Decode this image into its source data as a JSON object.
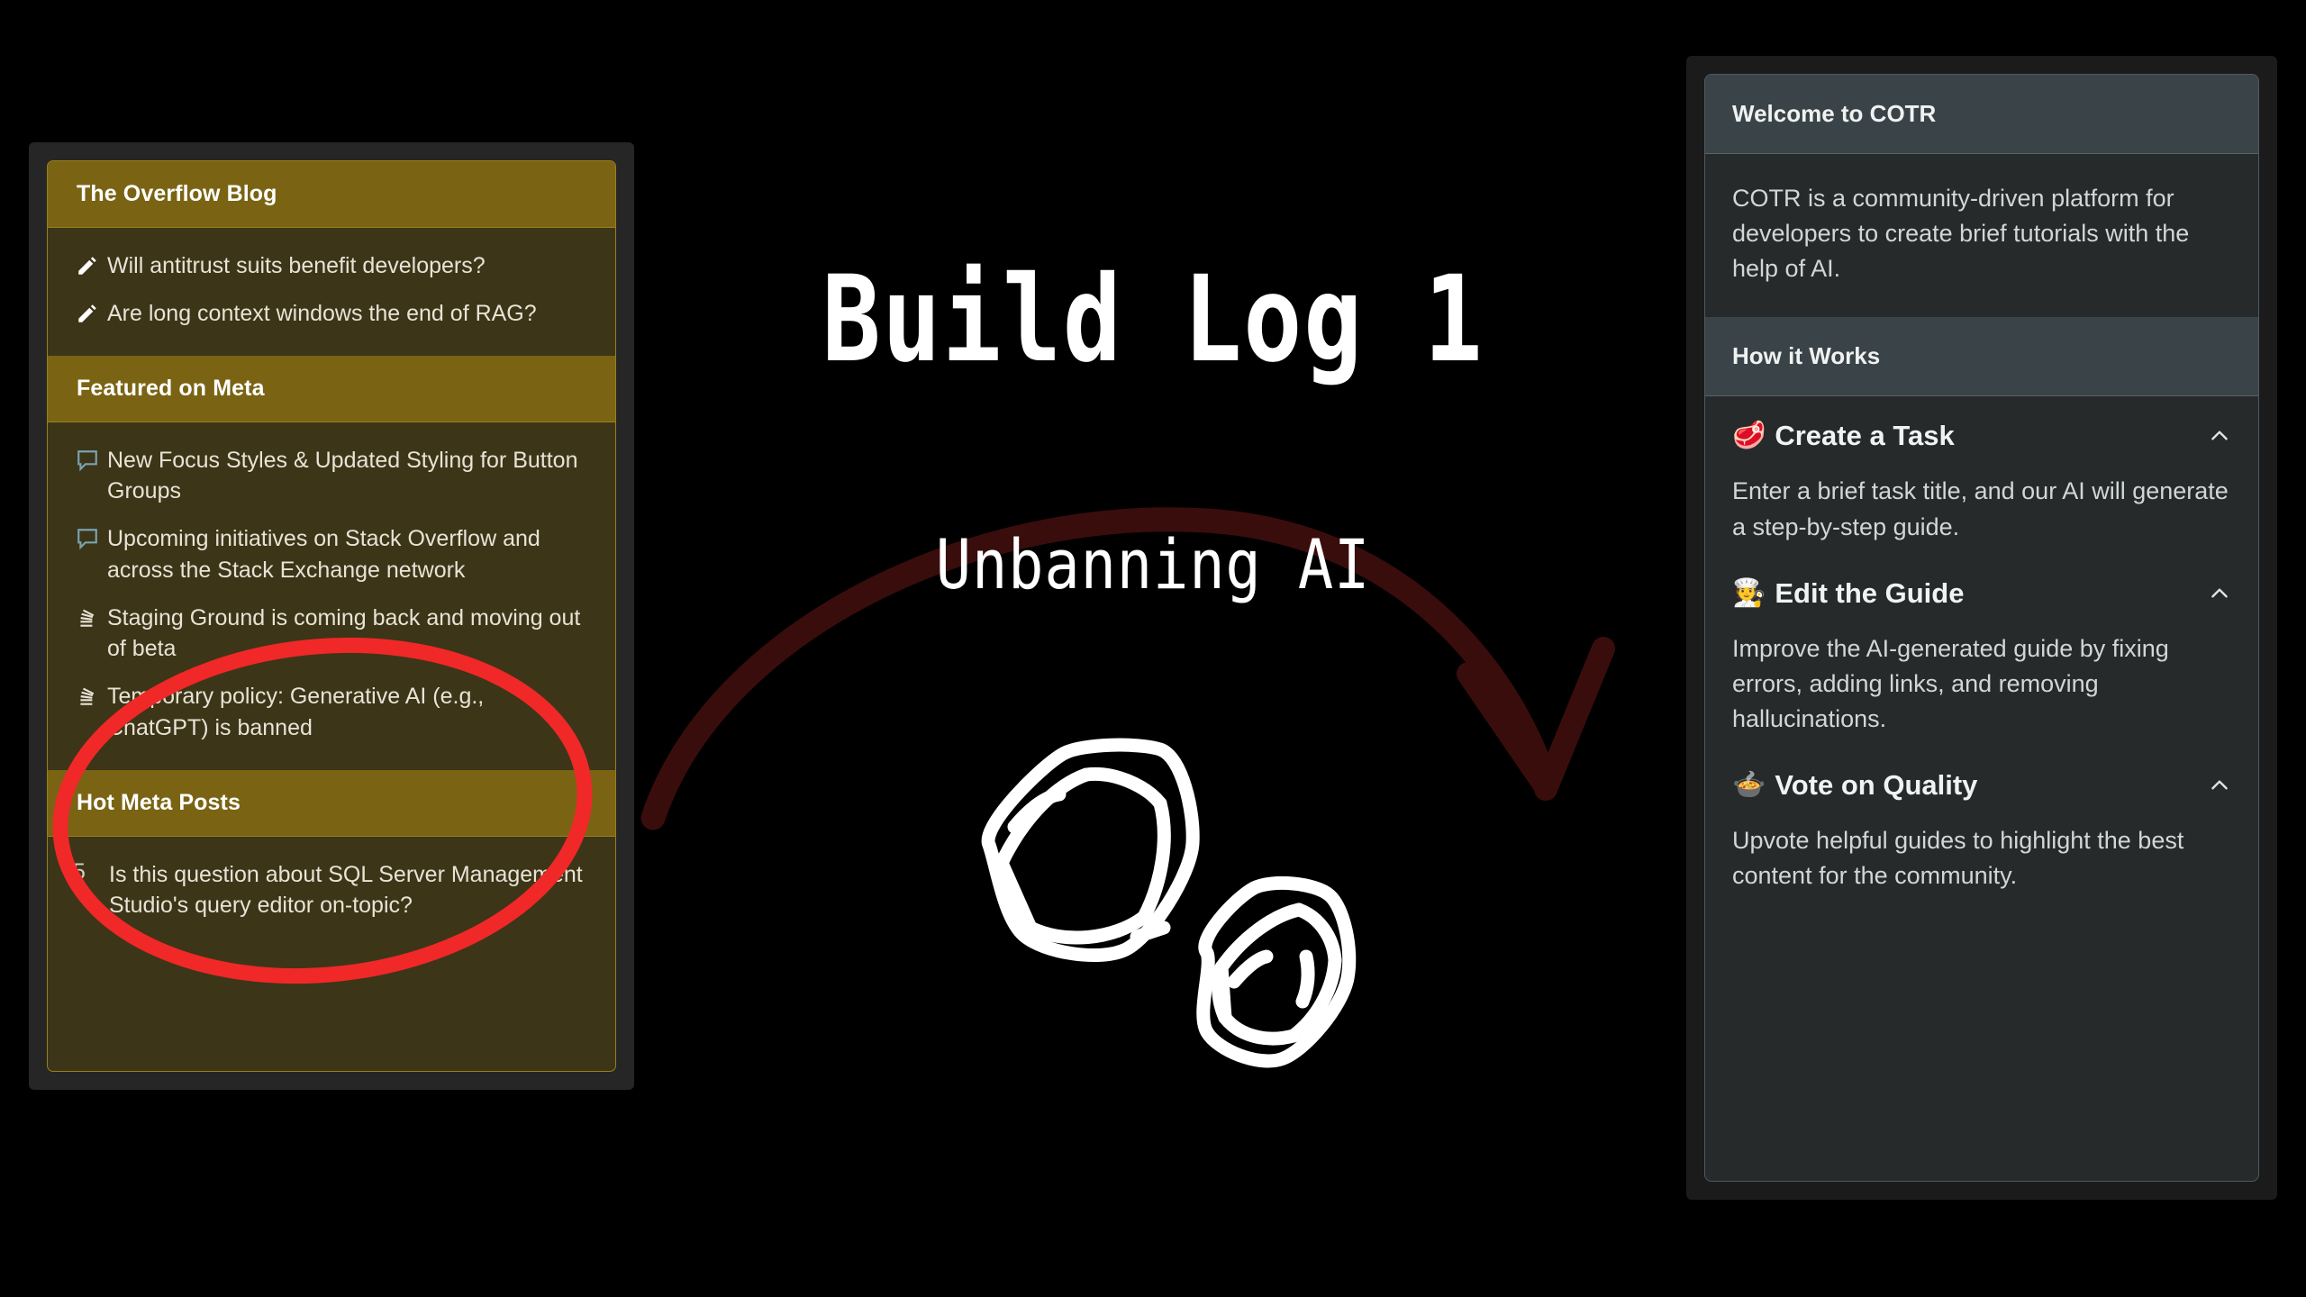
{
  "slide": {
    "title": "Build Log 1",
    "subtitle": "Unbanning AI",
    "background_color": "#000000"
  },
  "annotations": {
    "red_circle_color": "#f02828",
    "arrow_color": "#3a0d0d",
    "cube_doodle_color": "#ffffff",
    "cube_doodle_name": "ice-cubes-doodle"
  },
  "stack_overflow_sidebar": {
    "accent_color": "#7a6414",
    "sections": [
      {
        "header": "The Overflow Blog",
        "items": [
          {
            "icon": "pencil-icon",
            "text": "Will antitrust suits benefit developers?"
          },
          {
            "icon": "pencil-icon",
            "text": "Are long context windows the end of RAG?"
          }
        ]
      },
      {
        "header": "Featured on Meta",
        "items": [
          {
            "icon": "speech-bubble-icon",
            "text": "New Focus Styles & Updated Styling for Button Groups"
          },
          {
            "icon": "speech-bubble-icon",
            "text": "Upcoming initiatives on Stack Overflow and across the Stack Exchange network"
          },
          {
            "icon": "stacks-icon",
            "text": "Staging Ground is coming back and moving out of beta"
          },
          {
            "icon": "stacks-icon",
            "text": "Temporary policy: Generative AI (e.g., ChatGPT) is banned"
          }
        ]
      },
      {
        "header": "Hot Meta Posts",
        "items": [
          {
            "count": "5",
            "text": "Is this question about SQL Server Management Studio's query editor on-topic?"
          }
        ]
      }
    ]
  },
  "cotr_panel": {
    "welcome": {
      "header": "Welcome to COTR",
      "body": "COTR is a community-driven platform for developers to create brief tutorials with the help of AI."
    },
    "how_it_works": {
      "header": "How it Works",
      "items": [
        {
          "emoji": "🥩",
          "emoji_name": "cut-of-meat-emoji",
          "title": "Create a Task",
          "description": "Enter a brief task title, and our AI will generate a step-by-step guide.",
          "chevron": "chevron-up-icon"
        },
        {
          "emoji": "🧑‍🍳",
          "emoji_name": "chef-emoji",
          "title": "Edit the Guide",
          "description": "Improve the AI-generated guide by fixing errors, adding links, and removing hallucinations.",
          "chevron": "chevron-up-icon"
        },
        {
          "emoji": "🍲",
          "emoji_name": "pot-of-food-emoji",
          "title": "Vote on Quality",
          "description": "Upvote helpful guides to highlight the best content for the community.",
          "chevron": "chevron-up-icon"
        }
      ]
    }
  }
}
